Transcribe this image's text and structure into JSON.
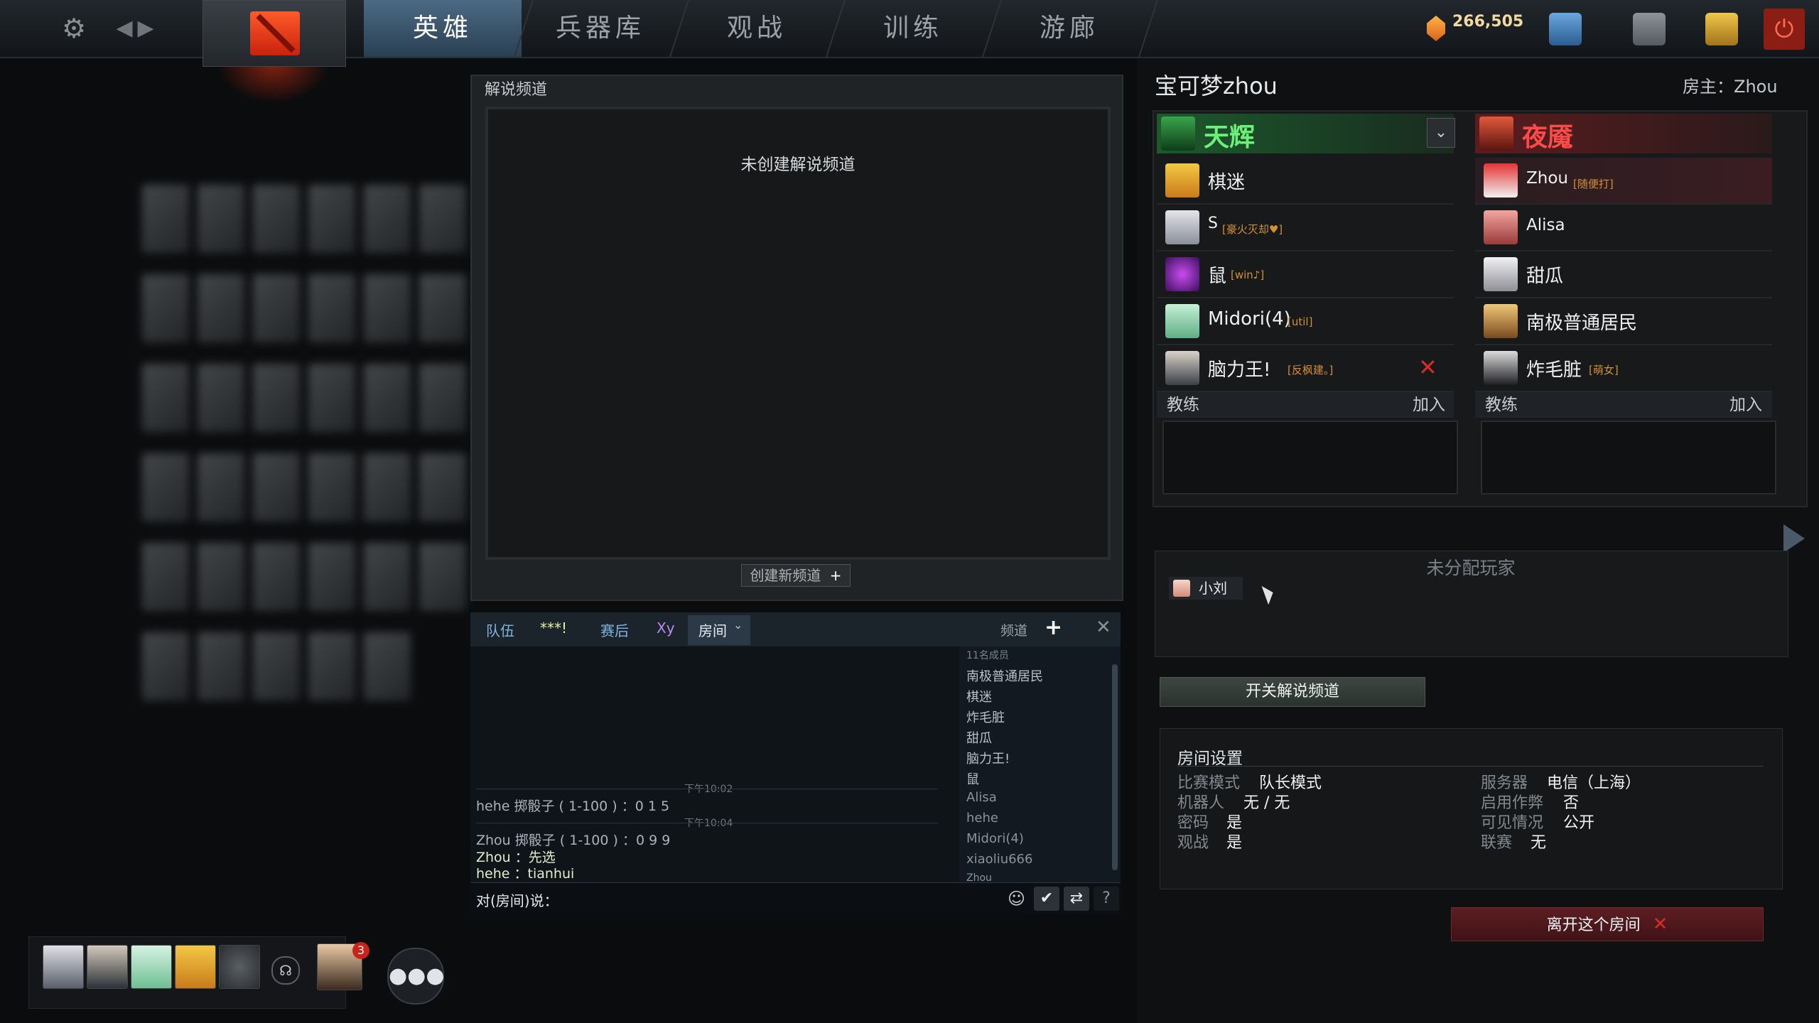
{
  "nav": {
    "tabs": [
      "英雄",
      "兵器库",
      "观战",
      "训练",
      "游廊"
    ],
    "active": "英雄",
    "gold": "266,505"
  },
  "broadcast": {
    "title": "解说频道",
    "empty_text": "未创建解说频道",
    "create_label": "创建新频道",
    "create_plus": "+"
  },
  "chat": {
    "tabs": [
      "队伍",
      "***!",
      "赛后",
      "Xy",
      "房间"
    ],
    "channel_label": "频道",
    "member_count": "11名成员",
    "members": [
      "南极普通居民",
      "棋迷",
      "炸毛脏",
      "甜瓜",
      "脑力王!",
      "鼠",
      "Alisa",
      "hehe",
      "Midori(4)",
      "xiaoliu666",
      "Zhou"
    ],
    "messages": [
      {
        "time": "下午10:02",
        "line": "hehe 掷骰子 ( 1-100 ) ：0 1 5"
      },
      {
        "time": "下午10:04",
        "line": "Zhou 掷骰子 ( 1-100 ) ：0 9 9"
      },
      {
        "time": "",
        "line": "Zhou ：先选"
      },
      {
        "time": "",
        "line": "hehe ：tianhui"
      }
    ],
    "input_prefix": "对(房间)说："
  },
  "lobby": {
    "name": "宝可梦zhou",
    "host_label": "房主：Zhou",
    "radiant": {
      "title": "天辉",
      "players": [
        {
          "name": "棋迷",
          "tag": ""
        },
        {
          "name": "S",
          "tag": "[豪火灭却♥]"
        },
        {
          "name": "鼠",
          "tag": "[win♪]"
        },
        {
          "name": "Midori(4)",
          "tag": "[util]"
        },
        {
          "name": "脑力王!",
          "tag": "[反枫建。]"
        }
      ],
      "coach": "教练",
      "join": "加入"
    },
    "dire": {
      "title": "夜魇",
      "players": [
        {
          "name": "Zhou",
          "tag": "[随便打]"
        },
        {
          "name": "Alisa",
          "tag": ""
        },
        {
          "name": "甜瓜",
          "tag": ""
        },
        {
          "name": "南极普通居民",
          "tag": ""
        },
        {
          "name": "炸毛脏",
          "tag": "[萌女]"
        }
      ],
      "coach": "教练",
      "join": "加入"
    },
    "unassigned_title": "未分配玩家",
    "unassigned": [
      "小刘"
    ],
    "toggle_broadcast": "开关解说频道",
    "leave": "离开这个房间"
  },
  "settings": {
    "title": "房间设置",
    "left": [
      {
        "label": "比赛模式",
        "value": "队长模式"
      },
      {
        "label": "机器人",
        "value": "无 / 无"
      },
      {
        "label": "密码",
        "value": "是"
      },
      {
        "label": "观战",
        "value": "是"
      }
    ],
    "right": [
      {
        "label": "服务器",
        "value": "电信（上海）"
      },
      {
        "label": "启用作弊",
        "value": "否"
      },
      {
        "label": "可见情况",
        "value": "公开"
      },
      {
        "label": "联赛",
        "value": "无"
      }
    ]
  },
  "party": {
    "invites": "3"
  }
}
